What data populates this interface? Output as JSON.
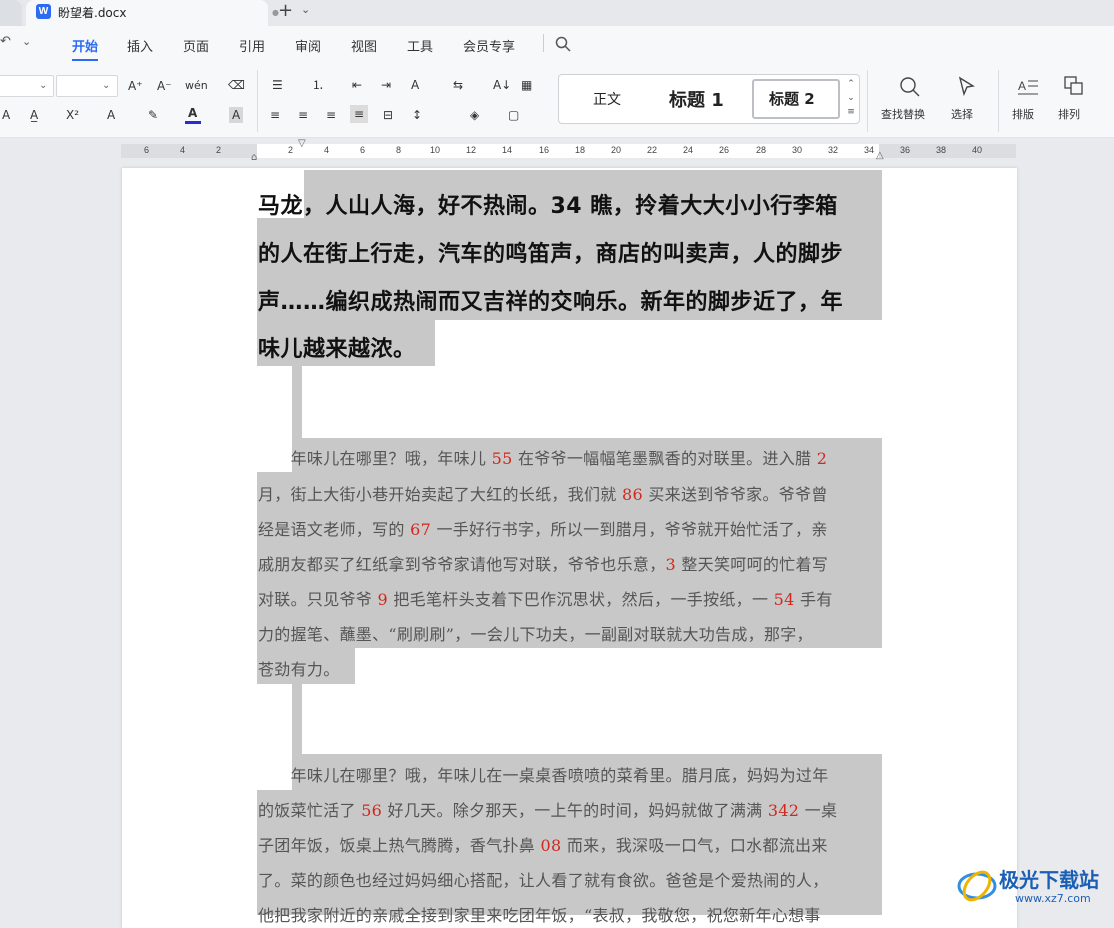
{
  "titlebar": {
    "doc_name": "盼望着.docx",
    "logo_letter": "W",
    "modified_dot": "●",
    "new_tab": "+",
    "new_tab_arrow": "⌄"
  },
  "menubar": {
    "undo_glyph": "↶",
    "undo_arrow": "⌄",
    "tabs": [
      "开始",
      "插入",
      "页面",
      "引用",
      "审阅",
      "视图",
      "工具",
      "会员专享"
    ]
  },
  "ribbon": {
    "row1": {
      "grow_font": "A⁺",
      "shrink_font": "A⁻",
      "phonetic": "wén",
      "clear_format": "⌫",
      "bullets": "☰",
      "numbering": "⒈",
      "indent_dec": "⇤",
      "indent_inc": "⇥",
      "text_dir": "A",
      "wrap": "⇆",
      "sort": "A↓",
      "col": "▦"
    },
    "row2": {
      "strike": "A",
      "superscript": "X²",
      "text_effect": "A",
      "highlight": "✎",
      "font_color": "A",
      "char_shade": "A",
      "align_left": "≡",
      "align_center": "≡",
      "align_right": "≡",
      "justify": "≡",
      "distributed": "⊟",
      "line_spacing": "↕",
      "shading": "◈",
      "border": "▢"
    },
    "styles": [
      "正文",
      "标题 1",
      "标题 2"
    ],
    "find_replace": "查找替换",
    "select": "选择",
    "layout": "排版",
    "arrange": "排列"
  },
  "ruler": {
    "ticks": [
      "6",
      "4",
      "2",
      "2",
      "4",
      "6",
      "8",
      "10",
      "12",
      "14",
      "16",
      "18",
      "20",
      "22",
      "24",
      "26",
      "28",
      "30",
      "32",
      "34",
      "36",
      "38",
      "40"
    ]
  },
  "document": {
    "heading_lines": [
      "马龙，人山人海，好不热闹。34 瞧，拎着大大小小行李箱",
      "的人在街上行走，汽车的鸣笛声，商店的叫卖声，人的脚步",
      "声……编织成热闹而又吉祥的交响乐。新年的脚步近了，年",
      "味儿越来越浓。"
    ],
    "para1": [
      [
        "　　年味儿在哪里？哦，年味儿 ",
        "55",
        " 在爷爷一幅幅笔墨飘香的对联里。进入腊 ",
        "2"
      ],
      [
        "月，街上大街小巷开始卖起了大红的长纸，我们就 ",
        "86",
        " 买来送到爷爷家。爷爷曾",
        ""
      ],
      [
        "经是语文老师，写的 ",
        "67",
        " 一手好行书字，所以一到腊月，爷爷就开始忙活了，亲",
        ""
      ],
      [
        "戚朋友都买了红纸拿到爷爷家请他写对联，爷爷也乐意，",
        "3",
        " 整天笑呵呵的忙着写",
        ""
      ],
      [
        "对联。只见爷爷 ",
        "9",
        " 把毛笔杆头支着下巴作沉思状，然后，一手按纸，一 ",
        "54"
      ],
      [
        "力的握笔、蘸墨、“刷刷刷”，一会儿下功夫，一副副对联就大功告成，那字，",
        "",
        "",
        ""
      ],
      [
        "苍劲有力。",
        "",
        "",
        ""
      ]
    ],
    "para1_line5_tail": " 手有",
    "para2": [
      [
        "　　年味儿在哪里？哦，年味儿在一桌桌香喷喷的菜肴里。腊月底，妈妈为过年",
        "",
        "",
        ""
      ],
      [
        "的饭菜忙活了 ",
        "56",
        " 好几天。除夕那天，一上午的时间，妈妈就做了满满 ",
        "342"
      ],
      [
        "子团年饭，饭桌上热气腾腾，香气扑鼻 ",
        "08",
        " 而来，我深吸一口气，口水都流出来",
        ""
      ],
      [
        "了。菜的颜色也经过妈妈细心搭配，让人看了就有食欲。爸爸是个爱热闹的人，",
        "",
        "",
        ""
      ],
      [
        "他把我家附近的亲戚全接到家里来吃团年饭，“表叔，我敬您，祝您新年心想事",
        "",
        "",
        ""
      ]
    ],
    "para2_line2_tail": " 一桌"
  },
  "watermark": {
    "brand": "极光下载站",
    "url": "www.xz7.com"
  },
  "colors": {
    "accent": "#2b6bf3",
    "number_red": "#d0281e",
    "selection_gray": "#c8c8c8"
  }
}
